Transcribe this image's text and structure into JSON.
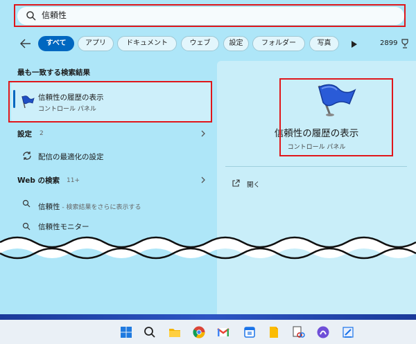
{
  "search": {
    "query": "信頼性"
  },
  "filters": {
    "items": [
      "すべて",
      "アプリ",
      "ドキュメント",
      "ウェブ",
      "設定",
      "フォルダー",
      "写真"
    ],
    "count": "2899"
  },
  "left": {
    "best_match_title": "最も一致する検索結果",
    "best_match": {
      "title": "信頼性の履歴の表示",
      "subtitle": "コントロール パネル"
    },
    "settings_label": "設定",
    "settings_count": "2",
    "settings_item": "配信の最適化の設定",
    "web_label": "Web の検索",
    "web_count": "11+",
    "web_items": [
      {
        "main": "信頼性",
        "suffix": " - 検索結果をさらに表示する"
      },
      {
        "main": "信頼性モニター",
        "suffix": ""
      }
    ]
  },
  "right": {
    "title": "信頼性の履歴の表示",
    "subtitle": "コントロール パネル",
    "open_label": "開く"
  },
  "colors": {
    "panel": "#aee6f8",
    "accent": "#0067c0",
    "annotation": "#e0161a"
  },
  "taskbar_icons": [
    "windows-start-icon",
    "search-icon",
    "file-explorer-icon",
    "chrome-icon",
    "gmail-icon",
    "calendar-icon",
    "notes-icon",
    "snipping-icon",
    "app-icon",
    "editor-icon"
  ]
}
